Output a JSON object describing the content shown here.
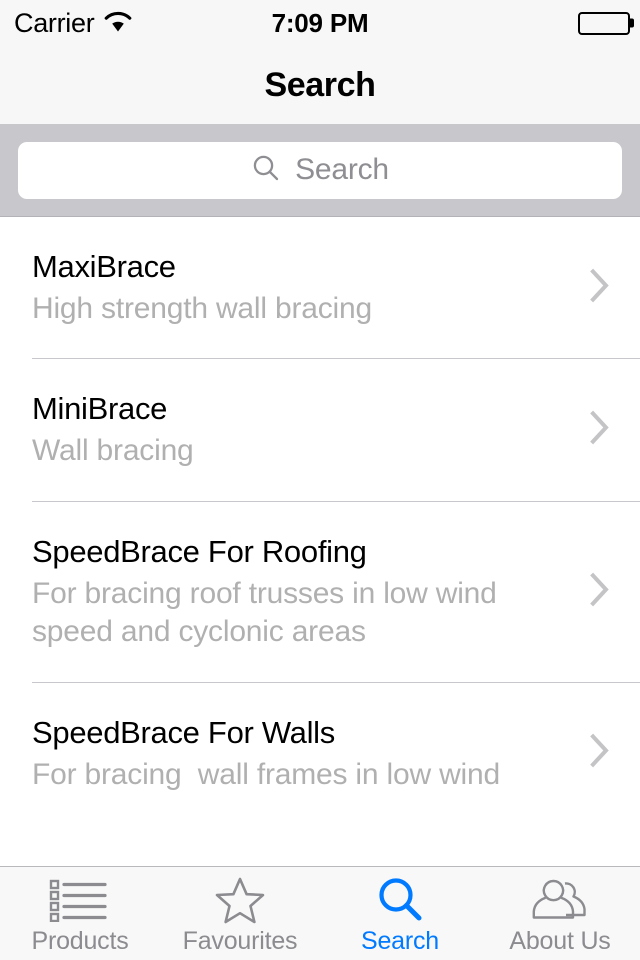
{
  "status_bar": {
    "carrier": "Carrier",
    "wifi_icon": "wifi-icon",
    "time": "7:09 PM",
    "battery_icon": "battery-full-icon"
  },
  "nav_bar": {
    "title": "Search"
  },
  "search": {
    "icon": "search-icon",
    "placeholder": "Search",
    "value": ""
  },
  "list": {
    "rows": [
      {
        "title": "MaxiBrace",
        "subtitle": "High strength wall bracing",
        "chevron": "chevron-right-icon"
      },
      {
        "title": "MiniBrace",
        "subtitle": "Wall bracing",
        "chevron": "chevron-right-icon"
      },
      {
        "title": "SpeedBrace For Roofing",
        "subtitle": "For bracing roof trusses in low wind speed and cyclonic areas",
        "chevron": "chevron-right-icon"
      },
      {
        "title": "SpeedBrace For Walls",
        "subtitle": "For bracing  wall frames in low wind",
        "chevron": "chevron-right-icon"
      }
    ]
  },
  "tab_bar": {
    "active_index": 2,
    "items": [
      {
        "label": "Products",
        "icon": "list-bullet-icon"
      },
      {
        "label": "Favourites",
        "icon": "star-outline-icon"
      },
      {
        "label": "Search",
        "icon": "search-icon"
      },
      {
        "label": "About Us",
        "icon": "people-icon"
      }
    ]
  },
  "colors": {
    "accent": "#007aff",
    "nav_background": "#f7f7f7",
    "searchbar_background": "#c8c7cc",
    "separator": "#c8c7cc",
    "subtitle_text": "#b0b0b0",
    "tab_inactive": "#8b8b90",
    "tabbar_background": "#f8f8f8"
  }
}
